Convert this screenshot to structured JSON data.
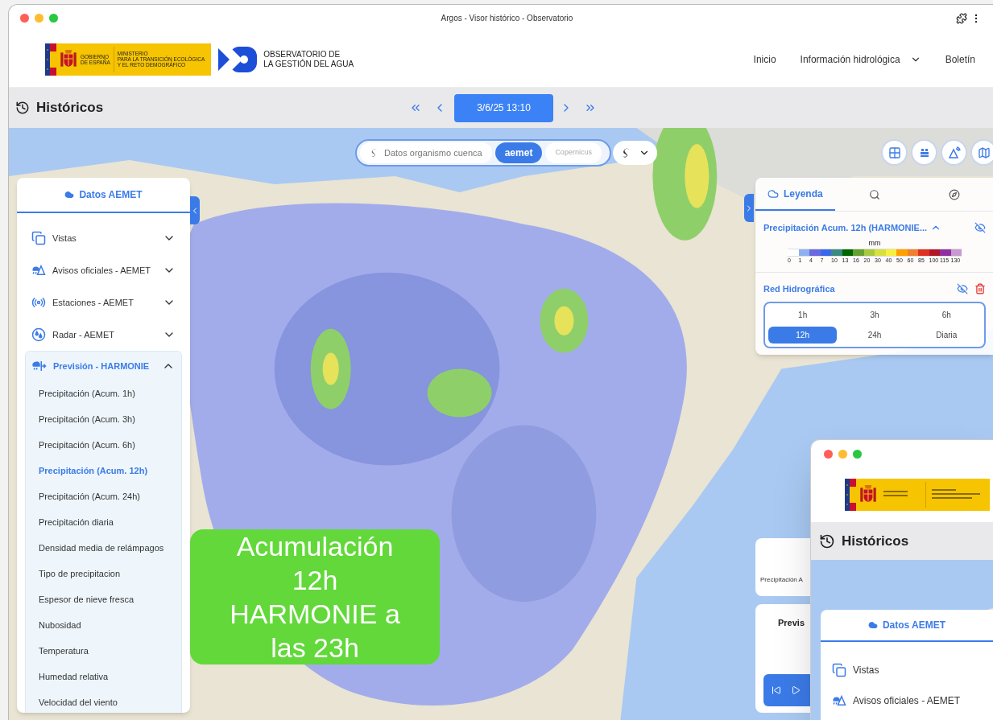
{
  "window": {
    "title": "Argos - Visor histórico - Observatorio"
  },
  "header": {
    "gov_logo": {
      "government": [
        "GOBIERNO",
        "DE ESPAÑA"
      ],
      "ministry": [
        "MINISTERIO",
        "PARA LA TRANSICIÓN ECOLÓGICA",
        "Y EL RETO DEMOGRÁFICO"
      ]
    },
    "brand": [
      "OBSERVATORIO DE",
      "LA GESTIÓN DEL AGUA"
    ],
    "nav": [
      {
        "label": "Inicio",
        "has_dropdown": false
      },
      {
        "label": "Información hidrológica",
        "has_dropdown": true
      },
      {
        "label": "Boletín",
        "has_dropdown": false
      }
    ]
  },
  "toolbar": {
    "title": "Históricos",
    "date": "3/6/25 13:10"
  },
  "source_selector": {
    "options": [
      {
        "kind": "text",
        "label": "Datos organismo cuenca",
        "selected": false
      },
      {
        "kind": "logo",
        "label": "aemet",
        "selected": true
      },
      {
        "kind": "logo",
        "label": "Copernicus",
        "selected": false
      }
    ]
  },
  "map_tools": [
    {
      "kind": "grid"
    },
    {
      "kind": "stack"
    },
    {
      "kind": "signal"
    },
    {
      "kind": "map"
    }
  ],
  "sidebar": {
    "title": "Datos AEMET",
    "sections": [
      {
        "label": "Vistas",
        "kind": "views",
        "expanded": false
      },
      {
        "label": "Avisos oficiales - AEMET",
        "kind": "warnings",
        "expanded": false
      },
      {
        "label": "Estaciones - AEMET",
        "kind": "stations",
        "expanded": false
      },
      {
        "label": "Radar - AEMET",
        "kind": "radar",
        "expanded": false
      },
      {
        "label": "Previsión - HARMONIE",
        "kind": "forecast",
        "expanded": true,
        "children": [
          {
            "label": "Precipitación (Acum. 1h)",
            "selected": false
          },
          {
            "label": "Precipitación (Acum. 3h)",
            "selected": false
          },
          {
            "label": "Precipitación (Acum. 6h)",
            "selected": false
          },
          {
            "label": "Precipitación (Acum. 12h)",
            "selected": true
          },
          {
            "label": "Precipitación (Acum. 24h)",
            "selected": false
          },
          {
            "label": "Precipitación diaria",
            "selected": false
          },
          {
            "label": "Densidad media de relámpagos",
            "selected": false
          },
          {
            "label": "Tipo de precipitacion",
            "selected": false
          },
          {
            "label": "Espesor de nieve fresca",
            "selected": false
          },
          {
            "label": "Nubosidad",
            "selected": false
          },
          {
            "label": "Temperatura",
            "selected": false
          },
          {
            "label": "Humedad relativa",
            "selected": false
          },
          {
            "label": "Velocidad del viento",
            "selected": false
          }
        ]
      }
    ]
  },
  "legend": {
    "tabs": [
      {
        "kind": "legend",
        "label": "Leyenda",
        "selected": true
      },
      {
        "kind": "search",
        "selected": false
      },
      {
        "kind": "compass",
        "selected": false
      }
    ],
    "layers": [
      {
        "name": "Precipitación Acum. 12h (HARMONIE...",
        "expanded": true,
        "unit": "mm",
        "removable": false,
        "scale": [
          {
            "label": "0",
            "color": "#ffffff"
          },
          {
            "label": "1",
            "color": "#8fb0f0"
          },
          {
            "label": "4",
            "color": "#6a6ade"
          },
          {
            "label": "7",
            "color": "#3a68ec"
          },
          {
            "label": "10",
            "color": "#3a8a80"
          },
          {
            "label": "13",
            "color": "#006600"
          },
          {
            "label": "16",
            "color": "#66a030"
          },
          {
            "label": "20",
            "color": "#a8c840"
          },
          {
            "label": "30",
            "color": "#d8e040"
          },
          {
            "label": "40",
            "color": "#f8f040"
          },
          {
            "label": "50",
            "color": "#ffa000"
          },
          {
            "label": "60",
            "color": "#f08030"
          },
          {
            "label": "85",
            "color": "#e03020"
          },
          {
            "label": "100",
            "color": "#b01828"
          },
          {
            "label": "115",
            "color": "#9030a0"
          },
          {
            "label": "130",
            "color": "#c89ad0"
          }
        ]
      },
      {
        "name": "Red Hidrográfica",
        "removable": true
      }
    ],
    "periods": [
      {
        "label": "1h",
        "selected": false
      },
      {
        "label": "3h",
        "selected": false
      },
      {
        "label": "6h",
        "selected": false
      },
      {
        "label": "12h",
        "selected": true
      },
      {
        "label": "24h",
        "selected": false
      },
      {
        "label": "Diaria",
        "selected": false
      }
    ]
  },
  "annotation": {
    "lines": [
      "Acumulación",
      "12h",
      "HARMONIE a",
      "las 23h"
    ]
  },
  "side_cards": [
    {
      "kind": "layer",
      "text": "Precipitación A"
    },
    {
      "kind": "player",
      "title": "Previs"
    }
  ],
  "inset_window": {
    "title": "Históricos",
    "sidebar_title": "Datos AEMET",
    "items": [
      {
        "label": "Vistas",
        "kind": "views"
      },
      {
        "label": "Avisos oficiales - AEMET",
        "kind": "warnings"
      }
    ]
  }
}
